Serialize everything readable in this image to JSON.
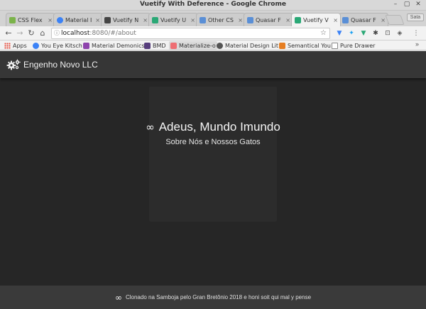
{
  "window": {
    "title": "Vuetify With Deference - Google Chrome"
  },
  "tabs": [
    {
      "label": "CSS Flex",
      "favicon_color": "#7bb34a",
      "active": false
    },
    {
      "label": "Material I",
      "favicon_color": "#3b82f6",
      "active": false
    },
    {
      "label": "Vuetify N",
      "favicon_color": "#444444",
      "active": false
    },
    {
      "label": "Vuetify U",
      "favicon_color": "#2aa876",
      "active": false
    },
    {
      "label": "Other CS",
      "favicon_color": "#5a8fd6",
      "active": false
    },
    {
      "label": "Quasar F",
      "favicon_color": "#5a8fd6",
      "active": false
    },
    {
      "label": "Vuetify V",
      "favicon_color": "#2aa876",
      "active": true
    },
    {
      "label": "Quasar F",
      "favicon_color": "#5a8fd6",
      "active": false
    }
  ],
  "profile_label": "Sata",
  "address": {
    "host": "localhost",
    "path": ":8080/#/about"
  },
  "bookmarks": {
    "apps_label": "Apps",
    "items": [
      {
        "label": "You Eye Kitsch",
        "icon_color": "#3b82f6",
        "active": false
      },
      {
        "label": "Material Demonics",
        "icon_color": "#8e44ad",
        "active": false
      },
      {
        "label": "BMD",
        "icon_color": "#563d7c",
        "active": false
      },
      {
        "label": "Materialize-o",
        "icon_color": "#ee6e73",
        "active": true
      },
      {
        "label": "Material Design Lit",
        "icon_color": "#555555",
        "active": false
      },
      {
        "label": "Semantical You",
        "icon_color": "#e67e22",
        "active": false
      },
      {
        "label": "Pure Drawer",
        "icon_color": "#888888",
        "active": false
      }
    ],
    "more_label": "»"
  },
  "app": {
    "brand": "Engenho Novo LLC",
    "heading": "Adeus, Mundo Imundo",
    "subheading": "Sobre Nós e Nossos Gatos",
    "infinity": "∞",
    "footer_text": "Clonado na Samboja pelo Gran Bretônio 2018 e honi soit qui mal y pense"
  },
  "colors": {
    "page_bg": "#262626",
    "appbar_bg": "#363636",
    "footer_bg": "#3a3a3a"
  }
}
